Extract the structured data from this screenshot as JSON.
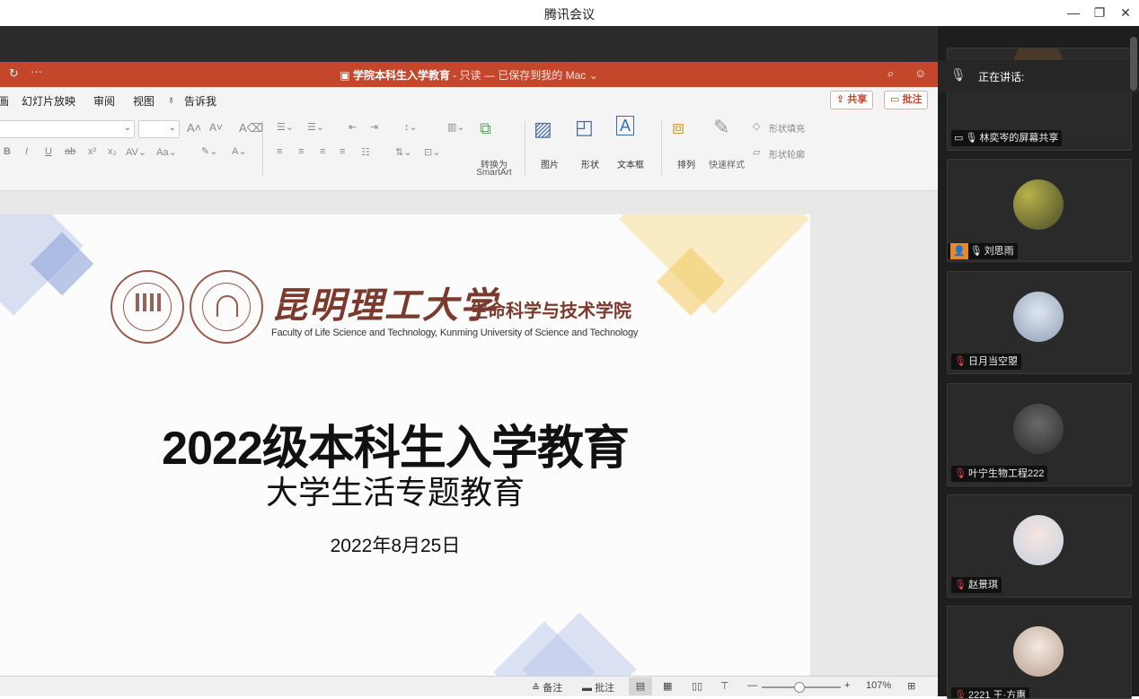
{
  "app": {
    "window_title": "腾讯会议",
    "controls": {
      "minimize": "—",
      "restore": "❐",
      "close": "✕"
    }
  },
  "ppt": {
    "doc_title": "学院本科生入学教育",
    "doc_status": " - 只读 — 已保存到我的 Mac",
    "menus": [
      "画",
      "幻灯片放映",
      "审阅",
      "视图",
      "告诉我"
    ],
    "share_label": "共享",
    "comment_label": "批注",
    "ribbon": {
      "convert_label_1": "转换为",
      "convert_label_2": "SmartArt",
      "picture_label": "图片",
      "shape_label": "形状",
      "textbox_label": "文本框",
      "arrange_label": "排列",
      "quick_style_label": "快速样式",
      "shape_fill_label": "形状填充",
      "shape_outline_label": "形状轮廓"
    },
    "slide": {
      "logo_cn": "昆明理工大学",
      "logo_college": "生命科学与技术学院",
      "logo_en": "Faculty of Life Science and Technology, Kunming University of Science and Technology",
      "title": "2022级本科生入学教育",
      "subtitle": "大学生活专题教育",
      "date": "2022年8月25日"
    },
    "status": {
      "notes_label": "备注",
      "comments_label": "批注",
      "zoom": "107%"
    }
  },
  "panel": {
    "speaking_label": "正在讲话:",
    "participants": [
      {
        "name": "林奕岑的屏幕共享"
      },
      {
        "name": "刘思雨"
      },
      {
        "name": "日月当空曌"
      },
      {
        "name": "叶宁生物工程222"
      },
      {
        "name": "赵景琪"
      },
      {
        "name": "2221 王·方惠"
      }
    ]
  },
  "colors": {
    "ppt_accent": "#c4472c",
    "meeting_bg": "#1e1e1e"
  }
}
